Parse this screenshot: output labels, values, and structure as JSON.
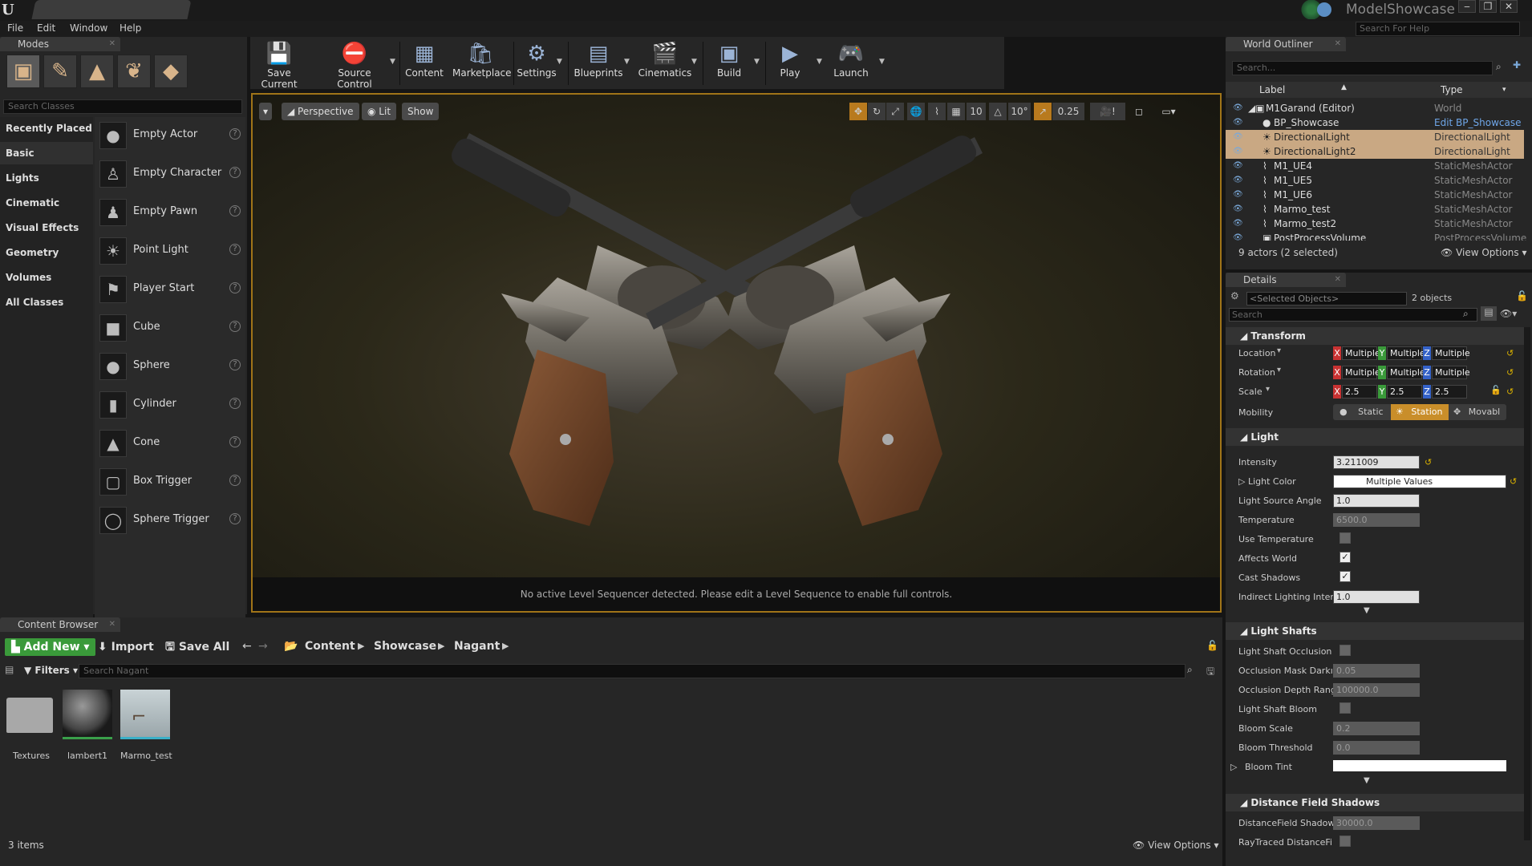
{
  "app": {
    "project_name": "ModelShowcase",
    "help_search_placeholder": "Search For Help"
  },
  "menu": [
    "File",
    "Edit",
    "Window",
    "Help"
  ],
  "modes": {
    "title": "Modes",
    "search_placeholder": "Search Classes",
    "categories": [
      "Recently Placed",
      "Basic",
      "Lights",
      "Cinematic",
      "Visual Effects",
      "Geometry",
      "Volumes",
      "All Classes"
    ],
    "items": [
      "Empty Actor",
      "Empty Character",
      "Empty Pawn",
      "Point Light",
      "Player Start",
      "Cube",
      "Sphere",
      "Cylinder",
      "Cone",
      "Box Trigger",
      "Sphere Trigger"
    ]
  },
  "toolbar": {
    "buttons": [
      "Save Current",
      "Source Control",
      "Content",
      "Marketplace",
      "Settings",
      "Blueprints",
      "Cinematics",
      "Build",
      "Play",
      "Launch"
    ]
  },
  "viewport": {
    "perspective": "Perspective",
    "lit": "Lit",
    "show": "Show",
    "grid_snap": "10",
    "rot_snap": "10°",
    "scale_snap": "0.25",
    "sequencer_message": "No active Level Sequencer detected. Please edit a Level Sequence to enable full controls."
  },
  "outliner": {
    "title": "World Outliner",
    "search_placeholder": "Search...",
    "col_label": "Label",
    "col_type": "Type",
    "rows": [
      {
        "label": "M1Garand (Editor)",
        "type": "World"
      },
      {
        "label": "BP_Showcase",
        "type": "Edit BP_Showcase"
      },
      {
        "label": "DirectionalLight",
        "type": "DirectionalLight"
      },
      {
        "label": "DirectionalLight2",
        "type": "DirectionalLight"
      },
      {
        "label": "M1_UE4",
        "type": "StaticMeshActor"
      },
      {
        "label": "M1_UE5",
        "type": "StaticMeshActor"
      },
      {
        "label": "M1_UE6",
        "type": "StaticMeshActor"
      },
      {
        "label": "Marmo_test",
        "type": "StaticMeshActor"
      },
      {
        "label": "Marmo_test2",
        "type": "StaticMeshActor"
      },
      {
        "label": "PostProcessVolume",
        "type": "PostProcessVolume"
      }
    ],
    "status": "9 actors (2 selected)",
    "view_options": "View Options"
  },
  "details": {
    "title": "Details",
    "selected_placeholder": "<Selected Objects>",
    "selected_count": "2 objects",
    "search_placeholder": "Search",
    "transform": {
      "section": "Transform",
      "location": "Location",
      "rotation": "Rotation",
      "scale": "Scale",
      "mobility": "Mobility",
      "multiple": "Multiple",
      "scale_value": "2.5",
      "mob_static": "Static",
      "mob_station": "Station",
      "mob_movable": "Movabl"
    },
    "light": {
      "section": "Light",
      "intensity_label": "Intensity",
      "intensity": "3.211009",
      "color_label": "Light Color",
      "color": "Multiple Values",
      "angle_label": "Light Source Angle",
      "angle": "1.0",
      "temp_label": "Temperature",
      "temp": "6500.0",
      "use_temp_label": "Use Temperature",
      "affects_label": "Affects World",
      "shadows_label": "Cast Shadows",
      "indirect_label": "Indirect Lighting Inten",
      "indirect": "1.0"
    },
    "shafts": {
      "section": "Light Shafts",
      "occlusion_label": "Light Shaft Occlusion",
      "mask_label": "Occlusion Mask Darkı",
      "mask": "0.05",
      "depth_label": "Occlusion Depth Rang",
      "depth": "100000.0",
      "bloom_label": "Light Shaft Bloom",
      "bscale_label": "Bloom Scale",
      "bscale": "0.2",
      "bthresh_label": "Bloom Threshold",
      "bthresh": "0.0",
      "btint_label": "Bloom Tint"
    },
    "dfs": {
      "section": "Distance Field Shadows",
      "dist_label": "DistanceField Shadow",
      "dist": "30000.0",
      "ray_label": "RayTraced DistanceFi"
    }
  },
  "content": {
    "title": "Content Browser",
    "add_new": "Add New",
    "import": "Import",
    "save_all": "Save All",
    "path": [
      "Content",
      "Showcase",
      "Nagant"
    ],
    "filters": "Filters",
    "search_placeholder": "Search Nagant",
    "assets": [
      "Textures",
      "lambert1",
      "Marmo_test"
    ],
    "count": "3 items",
    "view_options": "View Options"
  },
  "colors": {
    "accent_orange": "#a07418",
    "selection": "#c9a883",
    "add_new_green": "#3a9a3a"
  }
}
